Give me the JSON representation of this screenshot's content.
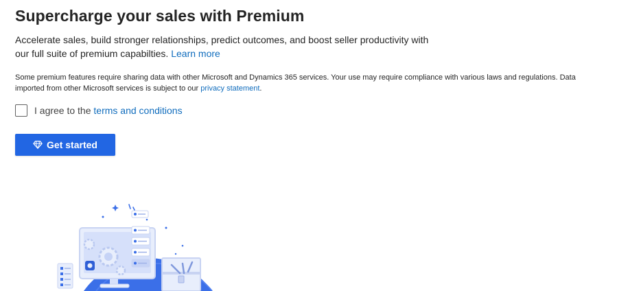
{
  "header": {
    "title": "Supercharge your sales with Premium"
  },
  "description": {
    "text": "Accelerate sales, build stronger relationships, predict outcomes, and boost seller productivity with our full suite of premium capabilties. ",
    "learn_more": "Learn more"
  },
  "disclaimer": {
    "text": "Some premium features require sharing data with other Microsoft and Dynamics 365 services. Your use may require compliance with various laws and regulations. Data imported from other Microsoft services is subject to our ",
    "privacy_link": "privacy statement",
    "suffix": "."
  },
  "agreement": {
    "prefix": "I agree to the ",
    "terms_link": "terms and conditions",
    "checked": false
  },
  "actions": {
    "get_started_label": "Get started",
    "get_started_icon": "diamond-icon"
  },
  "colors": {
    "accent": "#2266e3",
    "link": "#0f6cbd",
    "illustration_blue": "#3b6fe8"
  }
}
